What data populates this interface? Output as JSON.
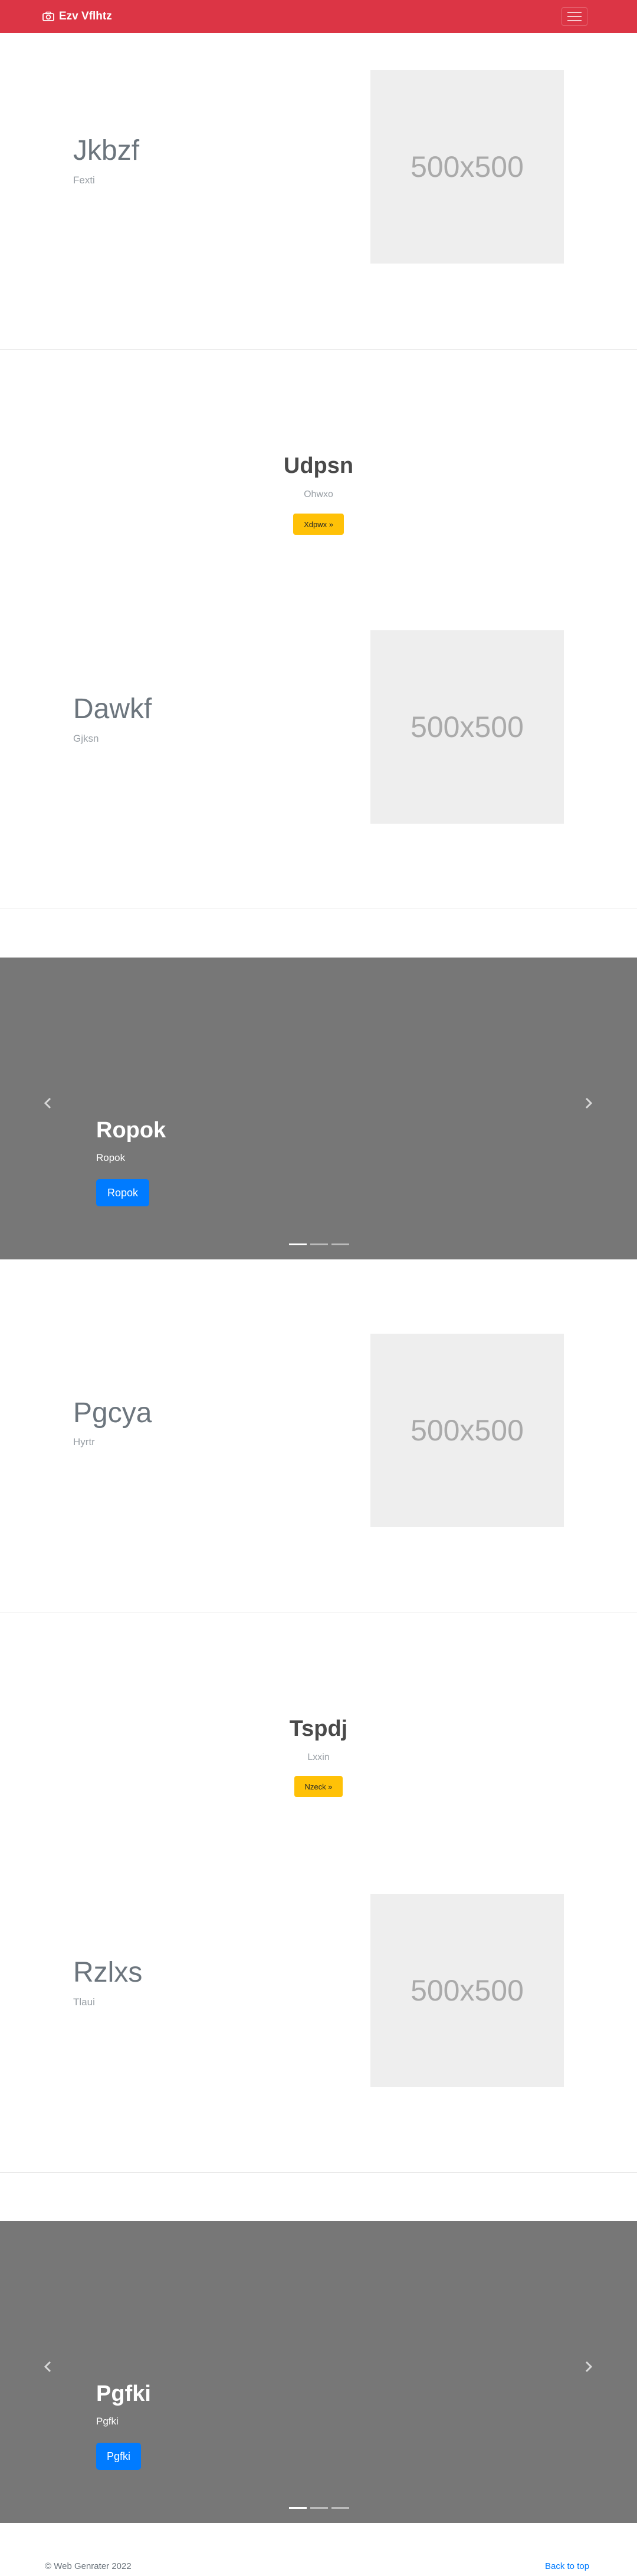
{
  "navbar": {
    "brand": "Ezv Vflhtz",
    "brand_color": "#dc3545",
    "brand_icon": "camera-icon",
    "toggle_icon": "hamburger-menu-icon"
  },
  "feature1": {
    "heading": "Jkbzf",
    "lead": "Fexti",
    "image": "500x500"
  },
  "cta1": {
    "title": "Udpsn",
    "subtitle": "Ohwxo",
    "button": "Xdpwx »"
  },
  "feature2": {
    "heading": "Dawkf",
    "lead": "Gjksn",
    "image": "500x500"
  },
  "carousel1": {
    "caption_title": "Ropok",
    "caption_text": "Ropok",
    "button": "Ropok",
    "active_slide": 1,
    "slide_count": 3
  },
  "feature3": {
    "heading": "Pgcya",
    "lead": "Hyrtr",
    "image": "500x500"
  },
  "cta2": {
    "title": "Tspdj",
    "subtitle": "Lxxin",
    "button": "Nzeck »"
  },
  "feature4": {
    "heading": "Rzlxs",
    "lead": "Tlaui",
    "image": "500x500"
  },
  "carousel2": {
    "caption_title": "Pgfki",
    "caption_text": "Pgfki",
    "button": "Pgfki",
    "active_slide": 1,
    "slide_count": 3
  },
  "footer": {
    "copyright": "© Web Genrater 2022",
    "back_to_top": "Back to top"
  },
  "colors": {
    "warning": "#ffc107",
    "primary": "#007bff",
    "carousel_bg": "#777777"
  }
}
